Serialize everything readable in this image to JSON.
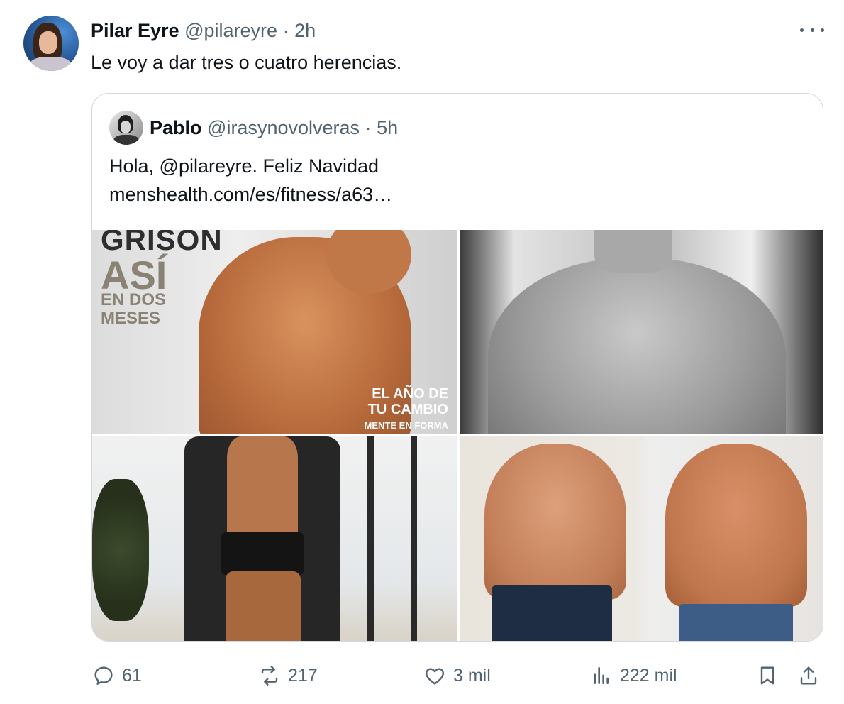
{
  "tweet": {
    "author_name": "Pilar Eyre",
    "handle": "@pilareyre",
    "separator": "·",
    "time": "2h",
    "text": "Le voy a dar tres o cuatro herencias."
  },
  "quote": {
    "author_name": "Pablo",
    "handle": "@irasynovolveras",
    "separator": "·",
    "time": "5h",
    "text_line1": "Hola, @pilareyre. Feliz Navidad",
    "text_line2": "menshealth.com/es/fitness/a63…"
  },
  "media": {
    "image1": {
      "title_partial": "GRISON",
      "headline": "ASÍ",
      "line1": "EN DOS",
      "line2": "MESES",
      "right_line1": "EL AÑO DE",
      "right_line2": "TU CAMBIO",
      "right_line3": "MENTE EN FORMA"
    }
  },
  "actions": {
    "replies": "61",
    "retweets": "217",
    "likes": "3 mil",
    "views": "222 mil"
  },
  "icons": [
    "more-icon",
    "reply-icon",
    "retweet-icon",
    "like-icon",
    "views-icon",
    "bookmark-icon",
    "share-icon"
  ],
  "colors": {
    "text": "#0f1419",
    "muted": "#536471",
    "border": "#cfd9de"
  }
}
